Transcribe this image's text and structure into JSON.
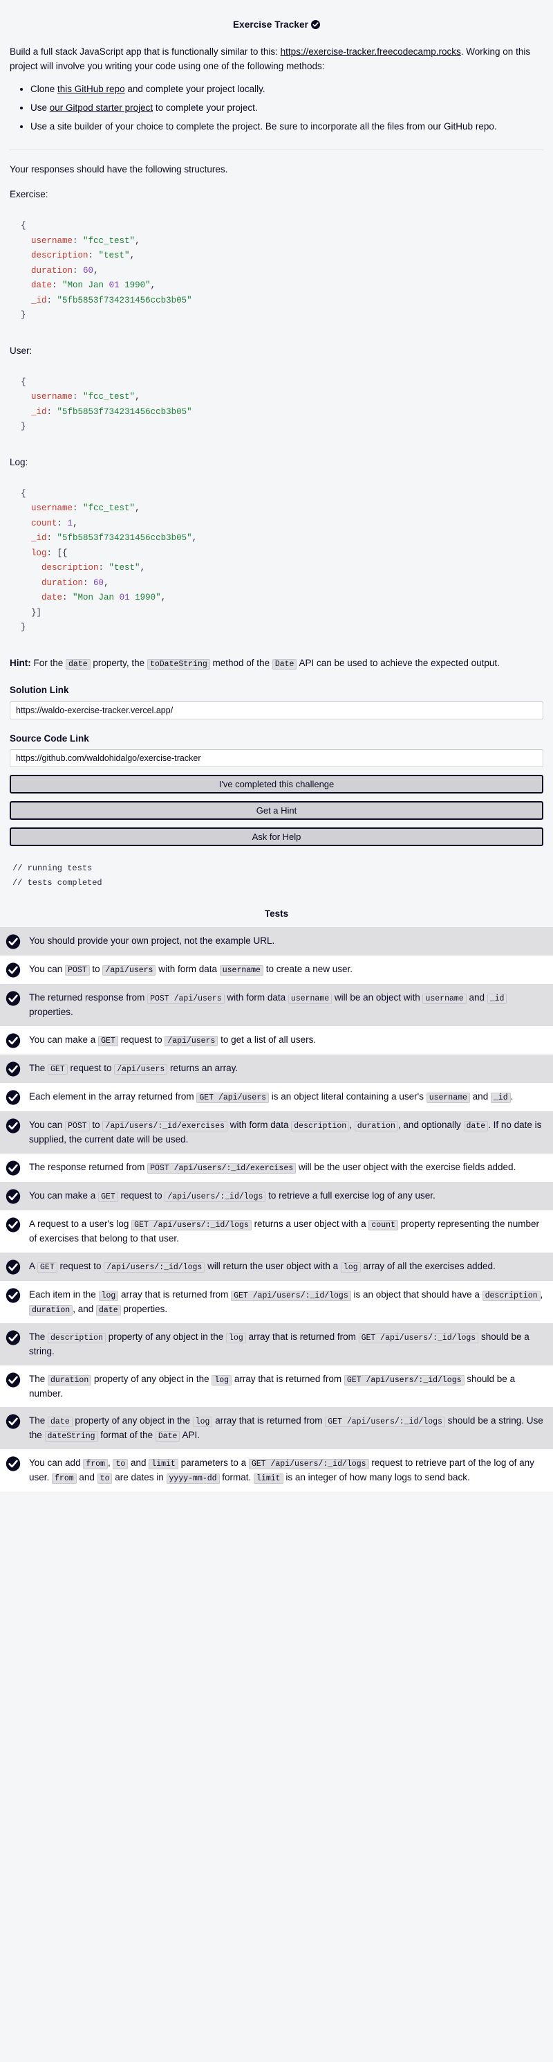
{
  "header": {
    "title": "Exercise Tracker",
    "badge_icon": "check-circle-icon"
  },
  "intro": {
    "text_before_link": "Build a full stack JavaScript app that is functionally similar to this: ",
    "link_text": "https://exercise-tracker.freecodecamp.rocks",
    "text_after_link": ". Working on this project will involve you writing your code using one of the following methods:",
    "methods": [
      {
        "before": "Clone ",
        "link": "this GitHub repo",
        "after": " and complete your project locally."
      },
      {
        "before": "Use ",
        "link": "our Gitpod starter project",
        "after": " to complete your project."
      },
      {
        "before": "Use a site builder of your choice to complete the project. Be sure to incorporate all the files from our GitHub repo.",
        "link": "",
        "after": ""
      }
    ]
  },
  "structures": {
    "lead": "Your responses should have the following structures.",
    "exercise_label": "Exercise:",
    "user_label": "User:",
    "log_label": "Log:",
    "exercise_code": "{\n  username: \"fcc_test\",\n  description: \"test\",\n  duration: 60,\n  date: \"Mon Jan 01 1990\",\n  _id: \"5fb5853f734231456ccb3b05\"\n}",
    "user_code": "{\n  username: \"fcc_test\",\n  _id: \"5fb5853f734231456ccb3b05\"\n}",
    "log_code": "{\n  username: \"fcc_test\",\n  count: 1,\n  _id: \"5fb5853f734231456ccb3b05\",\n  log: [{\n    description: \"test\",\n    duration: 60,\n    date: \"Mon Jan 01 1990\",\n  }]\n}"
  },
  "hint": {
    "label": "Hint:",
    "part1": " For the ",
    "code1": "date",
    "part2": " property, the ",
    "code2": "toDateString",
    "part3": " method of the ",
    "code3": "Date",
    "part4": " API can be used to achieve the expected output."
  },
  "form": {
    "solution_label": "Solution Link",
    "solution_value": "https://waldo-exercise-tracker.vercel.app/",
    "solution_placeholder": "",
    "source_label": "Source Code Link",
    "source_value": "https://github.com/waldohidalgo/exercise-tracker",
    "source_placeholder": "",
    "submit_label": "I've completed this challenge",
    "hint_label": "Get a Hint",
    "help_label": "Ask for Help"
  },
  "console": {
    "line1": "// running tests",
    "line2": "// tests completed"
  },
  "tests_section": {
    "heading": "Tests",
    "items": [
      {
        "status": "pass",
        "parts": [
          {
            "t": "text",
            "v": "You should provide your own project, not the example URL."
          }
        ]
      },
      {
        "status": "pass",
        "parts": [
          {
            "t": "text",
            "v": "You can "
          },
          {
            "t": "code",
            "v": "POST"
          },
          {
            "t": "text",
            "v": " to "
          },
          {
            "t": "code",
            "v": "/api/users"
          },
          {
            "t": "text",
            "v": " with form data "
          },
          {
            "t": "code",
            "v": "username"
          },
          {
            "t": "text",
            "v": " to create a new user."
          }
        ]
      },
      {
        "status": "pass",
        "parts": [
          {
            "t": "text",
            "v": "The returned response from "
          },
          {
            "t": "code",
            "v": "POST /api/users"
          },
          {
            "t": "text",
            "v": " with form data "
          },
          {
            "t": "code",
            "v": "username"
          },
          {
            "t": "text",
            "v": " will be an object with "
          },
          {
            "t": "code",
            "v": "username"
          },
          {
            "t": "text",
            "v": " and "
          },
          {
            "t": "code",
            "v": "_id"
          },
          {
            "t": "text",
            "v": " properties."
          }
        ]
      },
      {
        "status": "pass",
        "parts": [
          {
            "t": "text",
            "v": "You can make a "
          },
          {
            "t": "code",
            "v": "GET"
          },
          {
            "t": "text",
            "v": " request to "
          },
          {
            "t": "code",
            "v": "/api/users"
          },
          {
            "t": "text",
            "v": " to get a list of all users."
          }
        ]
      },
      {
        "status": "pass",
        "parts": [
          {
            "t": "text",
            "v": "The "
          },
          {
            "t": "code",
            "v": "GET"
          },
          {
            "t": "text",
            "v": " request to "
          },
          {
            "t": "code",
            "v": "/api/users"
          },
          {
            "t": "text",
            "v": " returns an array."
          }
        ]
      },
      {
        "status": "pass",
        "parts": [
          {
            "t": "text",
            "v": "Each element in the array returned from "
          },
          {
            "t": "code",
            "v": "GET /api/users"
          },
          {
            "t": "text",
            "v": " is an object literal containing a user's "
          },
          {
            "t": "code",
            "v": "username"
          },
          {
            "t": "text",
            "v": " and "
          },
          {
            "t": "code",
            "v": "_id"
          },
          {
            "t": "text",
            "v": "."
          }
        ]
      },
      {
        "status": "pass",
        "parts": [
          {
            "t": "text",
            "v": "You can "
          },
          {
            "t": "code",
            "v": "POST"
          },
          {
            "t": "text",
            "v": " to "
          },
          {
            "t": "code",
            "v": "/api/users/:_id/exercises"
          },
          {
            "t": "text",
            "v": " with form data "
          },
          {
            "t": "code",
            "v": "description"
          },
          {
            "t": "text",
            "v": ", "
          },
          {
            "t": "code",
            "v": "duration"
          },
          {
            "t": "text",
            "v": ", and optionally "
          },
          {
            "t": "code",
            "v": "date"
          },
          {
            "t": "text",
            "v": ". If no date is supplied, the current date will be used."
          }
        ]
      },
      {
        "status": "pass",
        "parts": [
          {
            "t": "text",
            "v": "The response returned from "
          },
          {
            "t": "code",
            "v": "POST /api/users/:_id/exercises"
          },
          {
            "t": "text",
            "v": " will be the user object with the exercise fields added."
          }
        ]
      },
      {
        "status": "pass",
        "parts": [
          {
            "t": "text",
            "v": "You can make a "
          },
          {
            "t": "code",
            "v": "GET"
          },
          {
            "t": "text",
            "v": " request to "
          },
          {
            "t": "code",
            "v": "/api/users/:_id/logs"
          },
          {
            "t": "text",
            "v": " to retrieve a full exercise log of any user."
          }
        ]
      },
      {
        "status": "pass",
        "parts": [
          {
            "t": "text",
            "v": "A request to a user's log "
          },
          {
            "t": "code",
            "v": "GET /api/users/:_id/logs"
          },
          {
            "t": "text",
            "v": " returns a user object with a "
          },
          {
            "t": "code",
            "v": "count"
          },
          {
            "t": "text",
            "v": " property representing the number of exercises that belong to that user."
          }
        ]
      },
      {
        "status": "pass",
        "parts": [
          {
            "t": "text",
            "v": "A "
          },
          {
            "t": "code",
            "v": "GET"
          },
          {
            "t": "text",
            "v": " request to "
          },
          {
            "t": "code",
            "v": "/api/users/:_id/logs"
          },
          {
            "t": "text",
            "v": " will return the user object with a "
          },
          {
            "t": "code",
            "v": "log"
          },
          {
            "t": "text",
            "v": " array of all the exercises added."
          }
        ]
      },
      {
        "status": "pass",
        "parts": [
          {
            "t": "text",
            "v": "Each item in the "
          },
          {
            "t": "code",
            "v": "log"
          },
          {
            "t": "text",
            "v": " array that is returned from "
          },
          {
            "t": "code",
            "v": "GET /api/users/:_id/logs"
          },
          {
            "t": "text",
            "v": " is an object that should have a "
          },
          {
            "t": "code",
            "v": "description"
          },
          {
            "t": "text",
            "v": ", "
          },
          {
            "t": "code",
            "v": "duration"
          },
          {
            "t": "text",
            "v": ", and "
          },
          {
            "t": "code",
            "v": "date"
          },
          {
            "t": "text",
            "v": " properties."
          }
        ]
      },
      {
        "status": "pass",
        "parts": [
          {
            "t": "text",
            "v": "The "
          },
          {
            "t": "code",
            "v": "description"
          },
          {
            "t": "text",
            "v": " property of any object in the "
          },
          {
            "t": "code",
            "v": "log"
          },
          {
            "t": "text",
            "v": " array that is returned from "
          },
          {
            "t": "code",
            "v": "GET /api/users/:_id/logs"
          },
          {
            "t": "text",
            "v": " should be a string."
          }
        ]
      },
      {
        "status": "pass",
        "parts": [
          {
            "t": "text",
            "v": "The "
          },
          {
            "t": "code",
            "v": "duration"
          },
          {
            "t": "text",
            "v": " property of any object in the "
          },
          {
            "t": "code",
            "v": "log"
          },
          {
            "t": "text",
            "v": " array that is returned from "
          },
          {
            "t": "code",
            "v": "GET /api/users/:_id/logs"
          },
          {
            "t": "text",
            "v": " should be a number."
          }
        ]
      },
      {
        "status": "pass",
        "parts": [
          {
            "t": "text",
            "v": "The "
          },
          {
            "t": "code",
            "v": "date"
          },
          {
            "t": "text",
            "v": " property of any object in the "
          },
          {
            "t": "code",
            "v": "log"
          },
          {
            "t": "text",
            "v": " array that is returned from "
          },
          {
            "t": "code",
            "v": "GET /api/users/:_id/logs"
          },
          {
            "t": "text",
            "v": " should be a string. Use the "
          },
          {
            "t": "code",
            "v": "dateString"
          },
          {
            "t": "text",
            "v": " format of the "
          },
          {
            "t": "code",
            "v": "Date"
          },
          {
            "t": "text",
            "v": " API."
          }
        ]
      },
      {
        "status": "pass",
        "parts": [
          {
            "t": "text",
            "v": "You can add "
          },
          {
            "t": "code",
            "v": "from"
          },
          {
            "t": "text",
            "v": ", "
          },
          {
            "t": "code",
            "v": "to"
          },
          {
            "t": "text",
            "v": " and "
          },
          {
            "t": "code",
            "v": "limit"
          },
          {
            "t": "text",
            "v": " parameters to a "
          },
          {
            "t": "code",
            "v": "GET /api/users/:_id/logs"
          },
          {
            "t": "text",
            "v": " request to retrieve part of the log of any user. "
          },
          {
            "t": "code",
            "v": "from"
          },
          {
            "t": "text",
            "v": " and "
          },
          {
            "t": "code",
            "v": "to"
          },
          {
            "t": "text",
            "v": " are dates in "
          },
          {
            "t": "code",
            "v": "yyyy-mm-dd"
          },
          {
            "t": "text",
            "v": " format. "
          },
          {
            "t": "code",
            "v": "limit"
          },
          {
            "t": "text",
            "v": " is an integer of how many logs to send back."
          }
        ]
      }
    ]
  },
  "colors": {
    "page_bg": "#f5f6f7",
    "text": "#0a0a23",
    "code_key": "#c9372c",
    "code_string": "#1a7f37",
    "code_number": "#7b3fb8",
    "row_alt_bg": "#dfdfe2",
    "button_bg": "#d0d0d5"
  }
}
